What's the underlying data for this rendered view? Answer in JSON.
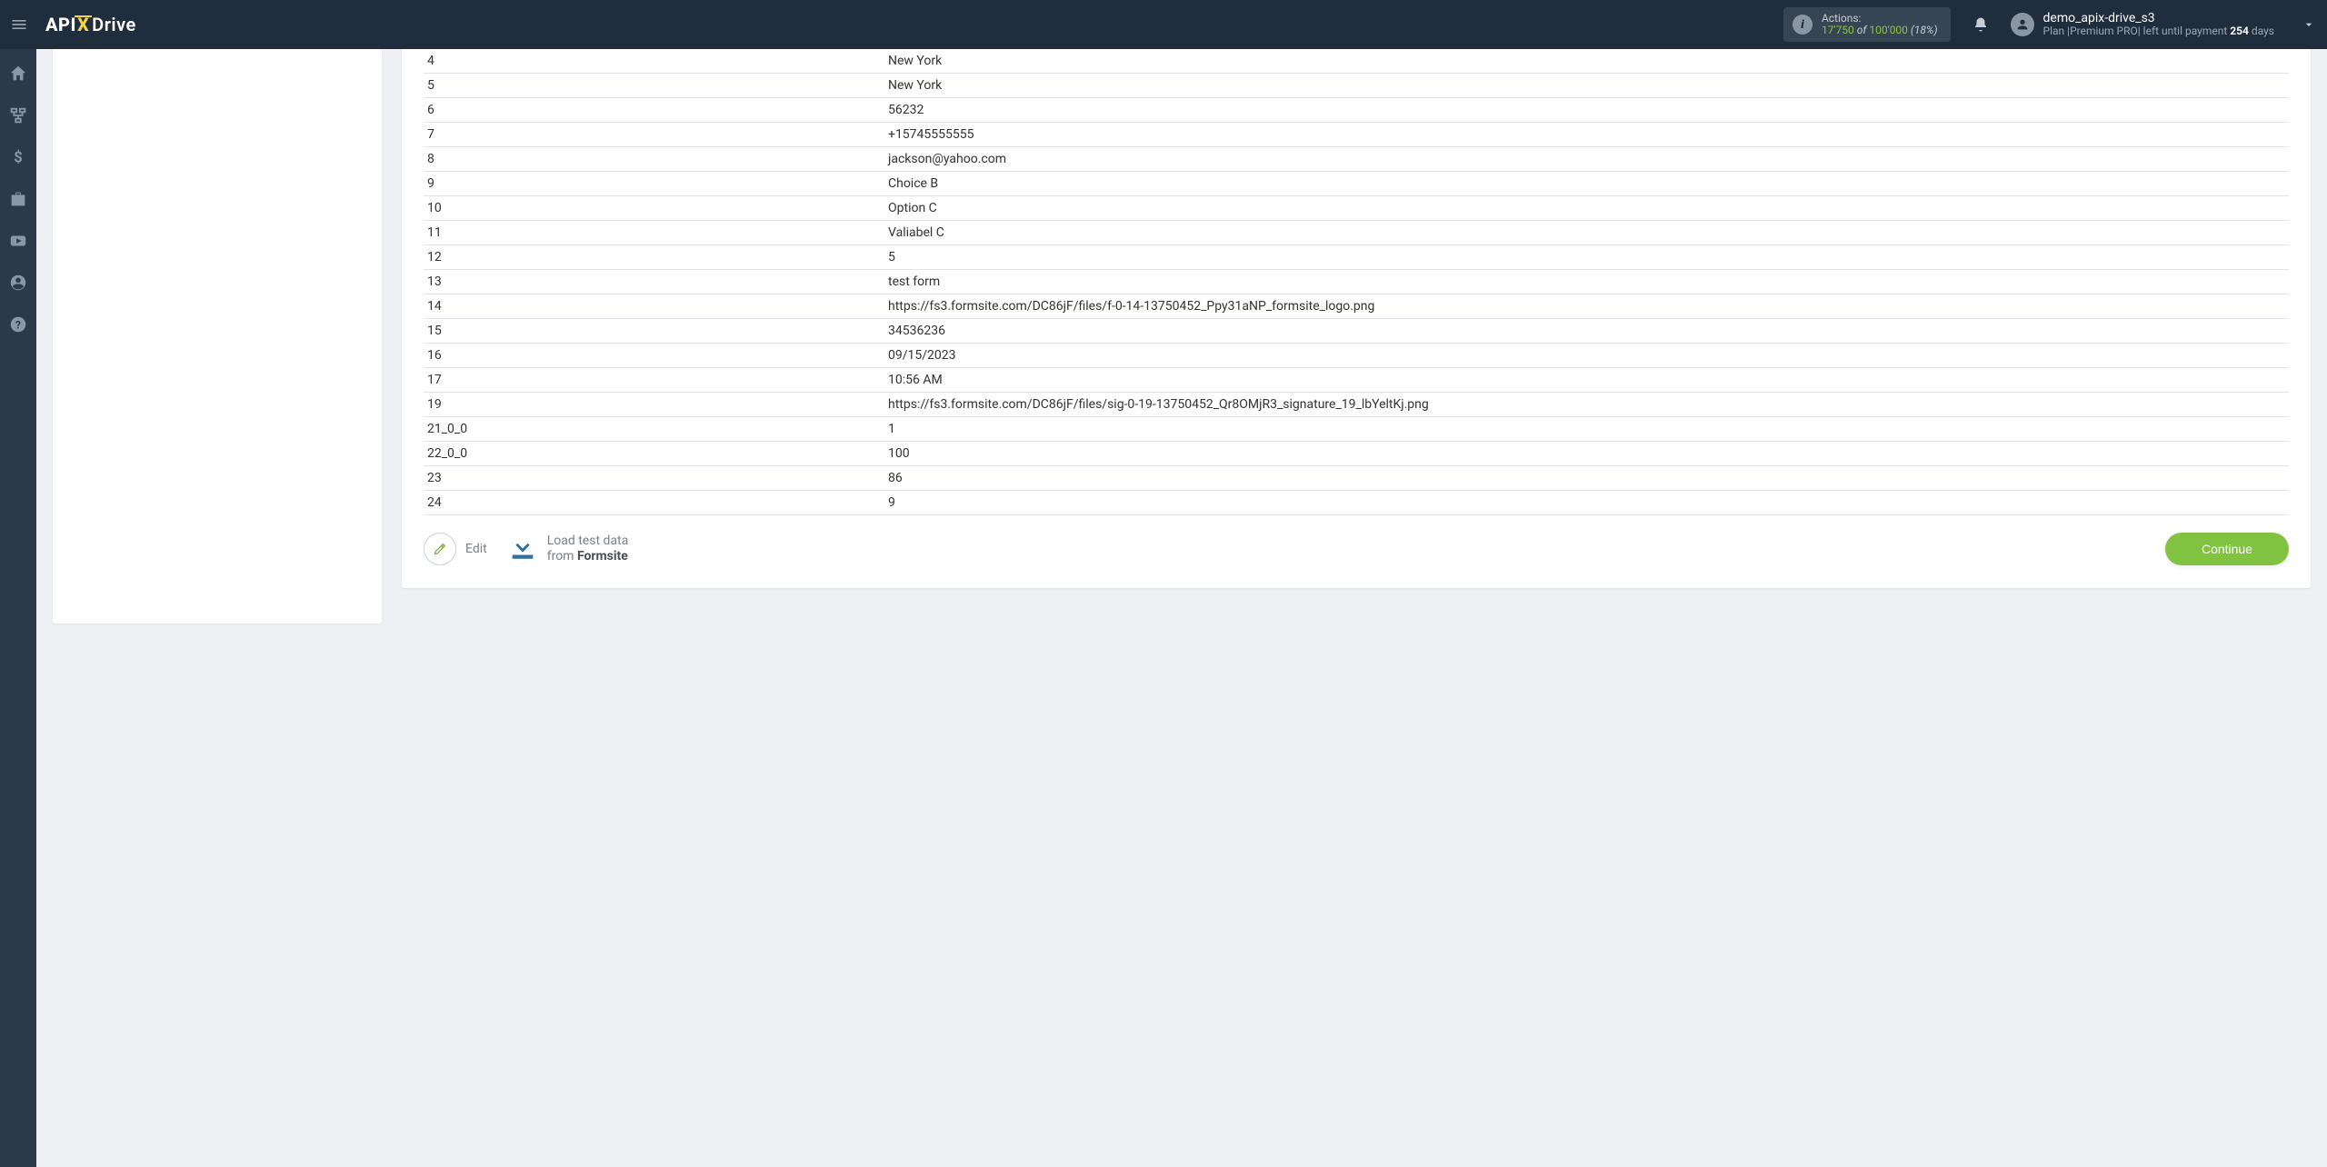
{
  "header": {
    "logo_api": "API",
    "logo_x": "X",
    "logo_drive": "Drive",
    "actions_label": "Actions:",
    "actions_used": "17'750",
    "actions_of": " of ",
    "actions_total": "100'000",
    "actions_pct": " (18%)",
    "username": "demo_apix-drive_s3",
    "plan_prefix": "Plan |",
    "plan_name": "Premium PRO",
    "plan_mid": "| left until payment",
    "plan_days": " 254 ",
    "plan_days_unit": "days"
  },
  "table": {
    "rows": [
      {
        "key": "4",
        "val": "New York"
      },
      {
        "key": "5",
        "val": "New York"
      },
      {
        "key": "6",
        "val": "56232"
      },
      {
        "key": "7",
        "val": "+15745555555"
      },
      {
        "key": "8",
        "val": "jackson@yahoo.com"
      },
      {
        "key": "9",
        "val": "Choice B"
      },
      {
        "key": "10",
        "val": "Option C"
      },
      {
        "key": "11",
        "val": "Valiabel C"
      },
      {
        "key": "12",
        "val": "5"
      },
      {
        "key": "13",
        "val": "test form"
      },
      {
        "key": "14",
        "val": "https://fs3.formsite.com/DC86jF/files/f-0-14-13750452_Ppy31aNP_formsite_logo.png"
      },
      {
        "key": "15",
        "val": "34536236"
      },
      {
        "key": "16",
        "val": "09/15/2023"
      },
      {
        "key": "17",
        "val": "10:56 AM"
      },
      {
        "key": "19",
        "val": "https://fs3.formsite.com/DC86jF/files/sig-0-19-13750452_Qr8OMjR3_signature_19_lbYeltKj.png"
      },
      {
        "key": "21_0_0",
        "val": "1"
      },
      {
        "key": "22_0_0",
        "val": "100"
      },
      {
        "key": "23",
        "val": "86"
      },
      {
        "key": "24",
        "val": "9"
      }
    ]
  },
  "footer": {
    "edit_label": "Edit",
    "load_line1": "Load test data",
    "load_line2_prefix": "from ",
    "load_source": "Formsite",
    "continue_label": "Continue"
  }
}
